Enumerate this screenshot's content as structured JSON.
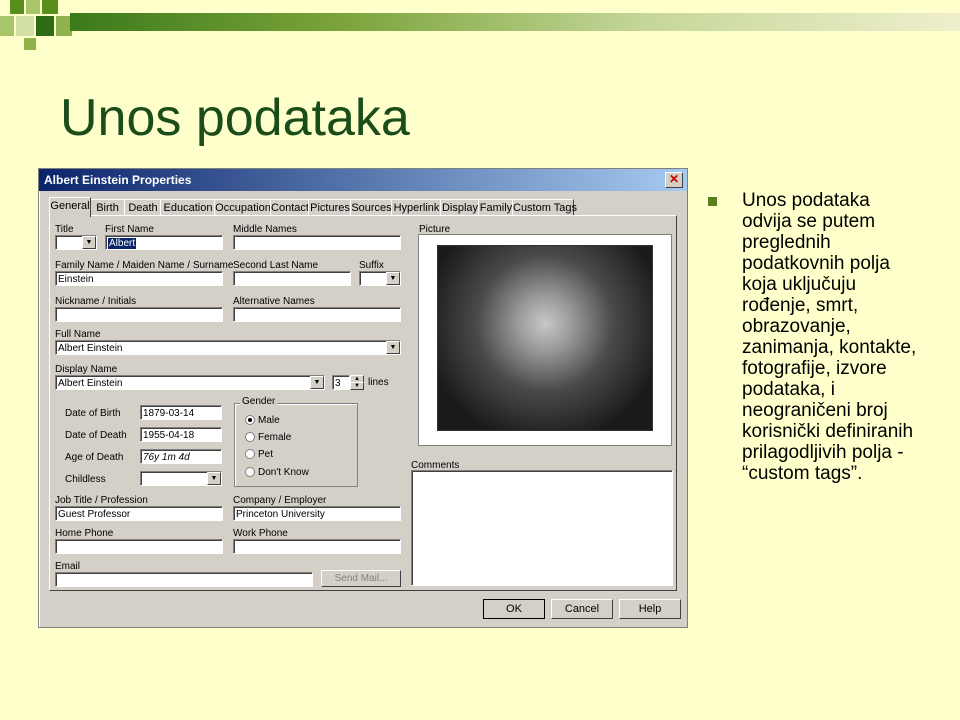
{
  "slide": {
    "title": "Unos podataka",
    "bullet": "Unos podataka odvija se putem preglednih podatkovnih polja koja uključuju rođenje, smrt, obrazovanje, zanimanja, kontakte, fotografije, izvore podataka, i neograničeni broj  korisnički definiranih prilagodljivih polja - “custom tags”."
  },
  "dialog": {
    "title": "Albert Einstein Properties",
    "tabs": [
      "General",
      "Birth",
      "Death",
      "Education",
      "Occupation",
      "Contact",
      "Pictures",
      "Sources",
      "Hyperlink",
      "Display",
      "Family",
      "Custom Tags"
    ],
    "labels": {
      "title": "Title",
      "first_name": "First Name",
      "middle_names": "Middle Names",
      "family_name": "Family Name / Maiden Name / Surname",
      "second_last_name": "Second Last Name",
      "suffix": "Suffix",
      "nickname": "Nickname / Initials",
      "alt_names": "Alternative Names",
      "full_name": "Full Name",
      "display_name": "Display Name",
      "lines": "lines",
      "dob": "Date of Birth",
      "dod": "Date of Death",
      "age": "Age of Death",
      "childless": "Childless",
      "gender": "Gender",
      "job": "Job Title / Profession",
      "company": "Company / Employer",
      "home_phone": "Home Phone",
      "work_phone": "Work Phone",
      "email": "Email",
      "picture": "Picture",
      "comments": "Comments"
    },
    "values": {
      "first_name": "Albert",
      "family_name": "Einstein",
      "full_name": "Albert Einstein",
      "display_name": "Albert Einstein",
      "lines": "3",
      "dob": "1879-03-14",
      "dod": "1955-04-18",
      "age": "76y 1m 4d",
      "job": "Guest Professor",
      "company": "Princeton University"
    },
    "gender_options": [
      "Male",
      "Female",
      "Pet",
      "Don't Know"
    ],
    "gender_selected": "Male",
    "buttons": {
      "send_mail": "Send Mail...",
      "ok": "OK",
      "cancel": "Cancel",
      "help": "Help"
    }
  },
  "colors": {
    "slide_bg": "#ffffcc",
    "title": "#1a4d1a",
    "accent": "#5a7f1e"
  }
}
